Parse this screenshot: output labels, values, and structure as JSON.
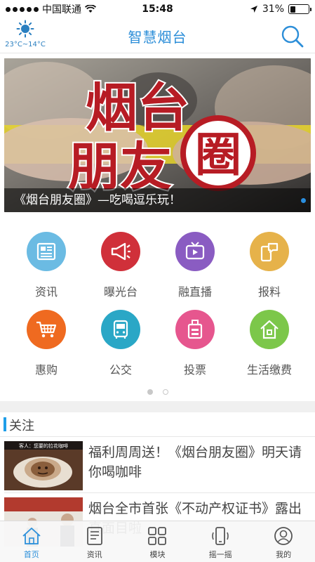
{
  "status_bar": {
    "carrier": "中国联通",
    "time": "15:48",
    "battery_percent": "31%",
    "battery_level": 0.31
  },
  "header": {
    "title": "智慧烟台",
    "weather_icon": "sun-icon",
    "temperature": "23°C~14°C",
    "search_icon": "search-icon"
  },
  "banner": {
    "logo_text": "烟台朋友圈",
    "caption": "《烟台朋友圈》—吃喝逗乐玩！",
    "active_indicator_color": "#2a8fe0"
  },
  "services": [
    {
      "label": "资讯",
      "icon": "newspaper-icon",
      "color": "#6bbbe3"
    },
    {
      "label": "曝光台",
      "icon": "megaphone-icon",
      "color": "#d0303a"
    },
    {
      "label": "融直播",
      "icon": "tv-icon",
      "color": "#8a5cc2"
    },
    {
      "label": "报料",
      "icon": "phone-chat-icon",
      "color": "#e6b24a"
    },
    {
      "label": "惠购",
      "icon": "cart-icon",
      "color": "#ef6a20"
    },
    {
      "label": "公交",
      "icon": "bus-icon",
      "color": "#2aa7c6"
    },
    {
      "label": "投票",
      "icon": "ballot-icon",
      "color": "#e6568e"
    },
    {
      "label": "生活缴费",
      "icon": "home-icon",
      "color": "#7cc74a"
    }
  ],
  "section": {
    "title": "关注"
  },
  "news": [
    {
      "title": "福利周周送！《烟台朋友圈》明天请你喝咖啡",
      "thumb_caption": "客人：您要的拉花咖啡"
    },
    {
      "title": "烟台全市首张《不动产权证书》露出真面目啦"
    }
  ],
  "tabs": [
    {
      "label": "首页",
      "icon": "home-icon",
      "active": true
    },
    {
      "label": "资讯",
      "icon": "document-icon",
      "active": false
    },
    {
      "label": "模块",
      "icon": "grid-icon",
      "active": false
    },
    {
      "label": "摇一摇",
      "icon": "shake-phone-icon",
      "active": false
    },
    {
      "label": "我的",
      "icon": "user-icon",
      "active": false
    }
  ],
  "colors": {
    "accent": "#2c8ed8",
    "section_bar": "#1f9ee8"
  }
}
